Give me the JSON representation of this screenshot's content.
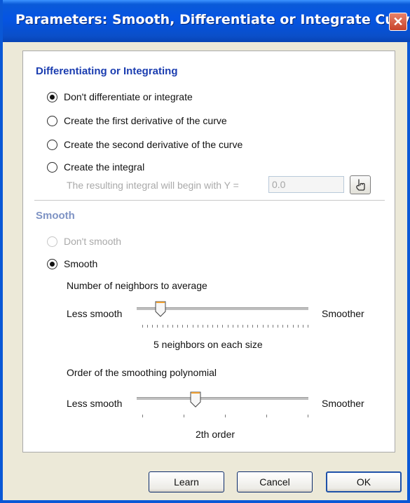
{
  "window": {
    "title": "Parameters: Smooth, Differentiate or Integrate Curve"
  },
  "diff": {
    "title": "Differentiating or Integrating",
    "options": [
      {
        "label": "Don't differentiate or integrate",
        "checked": true
      },
      {
        "label": "Create the first derivative of the curve",
        "checked": false
      },
      {
        "label": "Create the second derivative of the curve",
        "checked": false
      },
      {
        "label": "Create the integral",
        "checked": false
      }
    ],
    "integral_label": "The resulting integral will begin with Y =",
    "integral_value": "0.0"
  },
  "smooth": {
    "title": "Smooth",
    "options": [
      {
        "label": "Don't smooth",
        "checked": false,
        "disabled": true
      },
      {
        "label": "Smooth",
        "checked": true
      }
    ],
    "neighbors": {
      "label": "Number of neighbors to average",
      "left": "Less smooth",
      "right": "Smoother",
      "value_text": "5 neighbors on each size"
    },
    "order": {
      "label": "Order of the smoothing polynomial",
      "left": "Less smooth",
      "right": "Smoother",
      "value_text": "2th order"
    }
  },
  "buttons": {
    "learn": "Learn",
    "cancel": "Cancel",
    "ok": "OK"
  }
}
